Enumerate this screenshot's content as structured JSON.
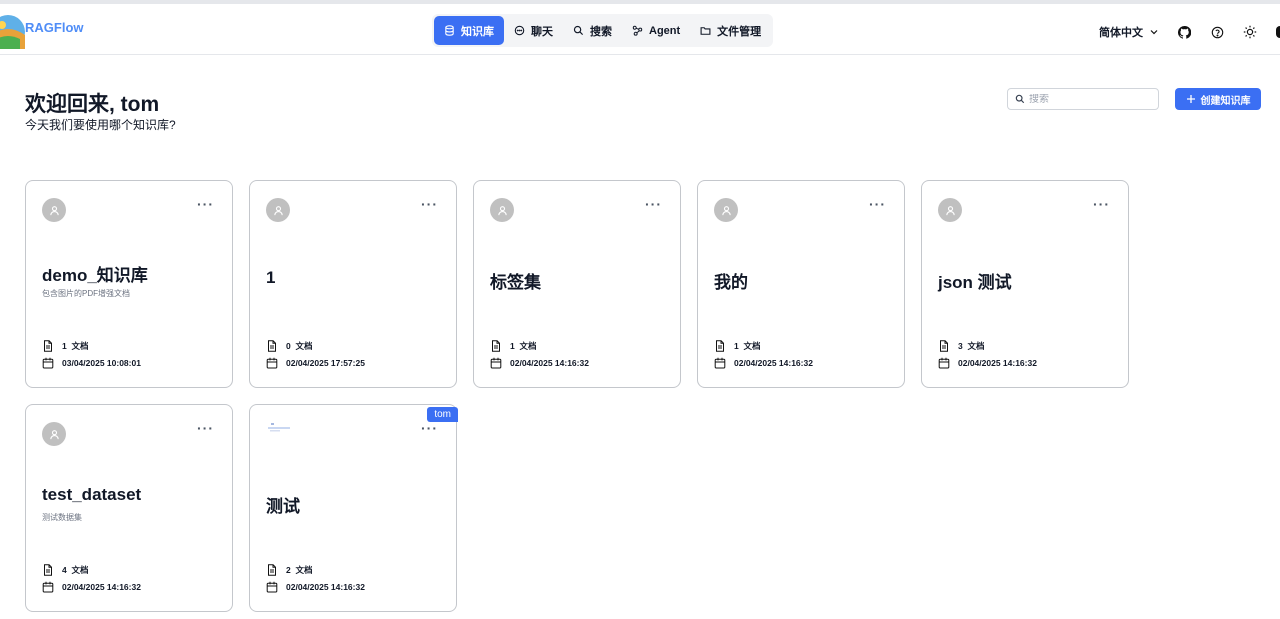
{
  "app": {
    "brand": "RAGFlow"
  },
  "nav": {
    "items": [
      {
        "label": "知识库",
        "icon": "database-icon",
        "active": true
      },
      {
        "label": "聊天",
        "icon": "chat-icon",
        "active": false
      },
      {
        "label": "搜索",
        "icon": "search-icon",
        "active": false
      },
      {
        "label": "Agent",
        "icon": "agent-icon",
        "active": false
      },
      {
        "label": "文件管理",
        "icon": "folder-icon",
        "active": false
      }
    ]
  },
  "header": {
    "language": "简体中文",
    "icons": [
      "github-icon",
      "help-icon",
      "theme-sun-icon"
    ]
  },
  "welcome": {
    "title": "欢迎回来, tom",
    "subtitle": "今天我们要使用哪个知识库?"
  },
  "search": {
    "placeholder": "搜索",
    "value": ""
  },
  "create_button": {
    "label": "创建知识库"
  },
  "cards": [
    {
      "name": "demo_知识库",
      "description": "包含图片的PDF增强文档",
      "doc_count": "1",
      "doc_unit": "文档",
      "date": "03/04/2025 10:08:01"
    },
    {
      "name": "1",
      "description": "",
      "doc_count": "0",
      "doc_unit": "文档",
      "date": "02/04/2025 17:57:25"
    },
    {
      "name": "标签集",
      "description": "",
      "doc_count": "1",
      "doc_unit": "文档",
      "date": "02/04/2025 14:16:32"
    },
    {
      "name": "我的",
      "description": "",
      "doc_count": "1",
      "doc_unit": "文档",
      "date": "02/04/2025 14:16:32"
    },
    {
      "name": "json 测试",
      "description": "",
      "doc_count": "3",
      "doc_unit": "文档",
      "date": "02/04/2025 14:16:32"
    },
    {
      "name": "test_dataset",
      "description": "测试数据集",
      "doc_count": "4",
      "doc_unit": "文档",
      "date": "02/04/2025 14:16:32"
    },
    {
      "name": "测试",
      "description": "",
      "doc_count": "2",
      "doc_unit": "文档",
      "date": "02/04/2025 14:16:32",
      "owner_tag": "tom"
    }
  ],
  "colors": {
    "accent": "#3b6ff3",
    "brand": "#4f8df7",
    "border": "#c4c7cc"
  }
}
